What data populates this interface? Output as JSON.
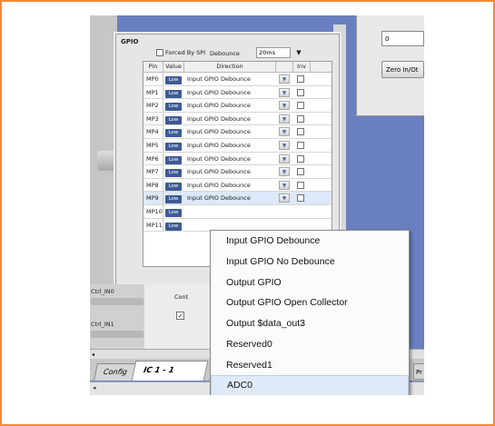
{
  "gpio_panel": {
    "title": "GPIO",
    "forced_by_spi_label": "Forced By SPI",
    "debounce_label": "Debounce",
    "debounce_value": "20ms",
    "columns": [
      "Pin",
      "Value",
      "Direction",
      "Inv"
    ],
    "rows": [
      {
        "pin": "MP0",
        "value": "Low",
        "direction": "Input GPIO Debounce"
      },
      {
        "pin": "MP1",
        "value": "Low",
        "direction": "Input GPIO Debounce"
      },
      {
        "pin": "MP2",
        "value": "Low",
        "direction": "Input GPIO Debounce"
      },
      {
        "pin": "MP3",
        "value": "Low",
        "direction": "Input GPIO Debounce"
      },
      {
        "pin": "MP4",
        "value": "Low",
        "direction": "Input GPIO Debounce"
      },
      {
        "pin": "MP5",
        "value": "Low",
        "direction": "Input GPIO Debounce"
      },
      {
        "pin": "MP6",
        "value": "Low",
        "direction": "Input GPIO Debounce"
      },
      {
        "pin": "MP7",
        "value": "Low",
        "direction": "Input GPIO Debounce"
      },
      {
        "pin": "MP8",
        "value": "Low",
        "direction": "Input GPIO Debounce"
      },
      {
        "pin": "MP9",
        "value": "Low",
        "direction": "Input GPIO Debounce"
      },
      {
        "pin": "MP10",
        "value": "Low",
        "direction": ""
      },
      {
        "pin": "MP11",
        "value": "Low",
        "direction": ""
      }
    ]
  },
  "right_panel": {
    "input_value": "0",
    "zero_button_label": "Zero In/Ot"
  },
  "left_controls": {
    "ctrl_in0": "Ctrl_IN0",
    "ctrl_in1": "Ctrl_IN1",
    "cont_label": "Cont",
    "cont_check": "✓"
  },
  "tabs": {
    "config": "Config",
    "ic": "IC 1 - 1",
    "partial": "Pr"
  },
  "direction_menu": {
    "items": [
      "Input  GPIO Debounce",
      "Input  GPIO No Debounce",
      "Output GPIO",
      "Output GPIO Open Collector",
      "Output $data_out3",
      "Reserved0",
      "Reserved1",
      "ADC0"
    ],
    "highlighted_index": 7
  },
  "colors": {
    "frame_border": "#f08a3c",
    "low_button": "#3e5a93",
    "background_blue": "#5e74b7"
  }
}
